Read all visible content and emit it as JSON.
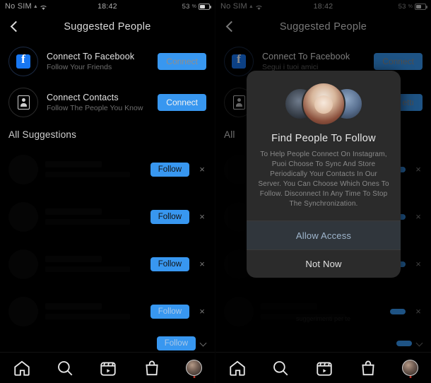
{
  "screens": [
    {
      "id": "left",
      "status_bar": {
        "carrier": "No SIM",
        "sim_marker": "▲",
        "wifi_icon": "wifi-icon",
        "time": "18:42",
        "battery_text": "53",
        "battery_pct_symbol": "%"
      },
      "header": {
        "back_icon": "back-chevron-icon",
        "title": "Suggested People"
      },
      "connect_rows": [
        {
          "icon": "facebook-icon",
          "title": "Connect To Facebook",
          "subtitle": "Follow Your Friends",
          "button": "Connect"
        },
        {
          "icon": "contacts-icon",
          "title": "Connect Contacts",
          "subtitle": "Follow The People You Know",
          "button": "Connect"
        }
      ],
      "section": {
        "title": "All Suggestions",
        "link": ""
      },
      "suggestions": [
        {
          "follow_label": "Follow",
          "dismiss": "×"
        },
        {
          "follow_label": "Follow",
          "dismiss": "×"
        },
        {
          "follow_label": "Follow",
          "dismiss": "×"
        },
        {
          "follow_label": "Follow",
          "dismiss": "×"
        },
        {
          "follow_label": "Follow",
          "dismiss": "×"
        }
      ],
      "tabbar": [
        {
          "icon": "home-icon",
          "label": "Home"
        },
        {
          "icon": "search-icon",
          "label": "Search"
        },
        {
          "icon": "reels-icon",
          "label": "Reels"
        },
        {
          "icon": "shop-icon",
          "label": "Shop"
        },
        {
          "icon": "profile-avatar",
          "label": "Profile"
        }
      ],
      "modal": null
    },
    {
      "id": "right",
      "status_bar": {
        "carrier": "No SIM",
        "sim_marker": "▲",
        "wifi_icon": "wifi-icon",
        "time": "18:42",
        "battery_text": "53",
        "battery_pct_symbol": "%"
      },
      "header": {
        "back_icon": "back-chevron-icon",
        "title": "Suggested People"
      },
      "connect_rows": [
        {
          "icon": "facebook-icon",
          "title": "Connect To Facebook",
          "subtitle": "Segui i tuoi amici",
          "button": "Connect"
        },
        {
          "icon": "contacts-icon",
          "title": "",
          "subtitle": "",
          "button": "ettı"
        }
      ],
      "section": {
        "title": "All",
        "link": ""
      },
      "suggestions": [
        {
          "follow_label": "",
          "dismiss": "×"
        },
        {
          "follow_label": "",
          "dismiss": "×"
        },
        {
          "follow_label": "",
          "dismiss": "×"
        },
        {
          "follow_label": "",
          "dismiss": "×"
        },
        {
          "follow_label": "",
          "dismiss": "×"
        }
      ],
      "tabbar": [
        {
          "icon": "home-icon",
          "label": "Home"
        },
        {
          "icon": "search-icon",
          "label": "Search"
        },
        {
          "icon": "reels-icon",
          "label": "Reels"
        },
        {
          "icon": "shop-icon",
          "label": "Shop"
        },
        {
          "icon": "profile-avatar",
          "label": "Profile"
        }
      ],
      "modal": {
        "avatars": [
          "avatar-left",
          "avatar-center",
          "avatar-right"
        ],
        "title": "Find People To Follow",
        "body": "To Help People Connect On Instagram, Puoi Choose To Sync And Store Periodically Your Contacts In Our Server. You Can Choose Which Ones To Follow. Disconnect In Any Time To Stop The Synchronization.",
        "primary_button": "Allow Access",
        "secondary_button": "Not Now",
        "behind_text": "suggerimenti per te"
      }
    }
  ],
  "colors": {
    "background": "#000000",
    "accent_blue": "#3897f0",
    "facebook_blue": "#1877f2",
    "modal_bg": "#2b2b2b",
    "primary_button_bg": "#30363c",
    "primary_button_text": "#9fb6cd",
    "text_primary": "#e2e2e2",
    "text_secondary": "#6e6e6e"
  }
}
